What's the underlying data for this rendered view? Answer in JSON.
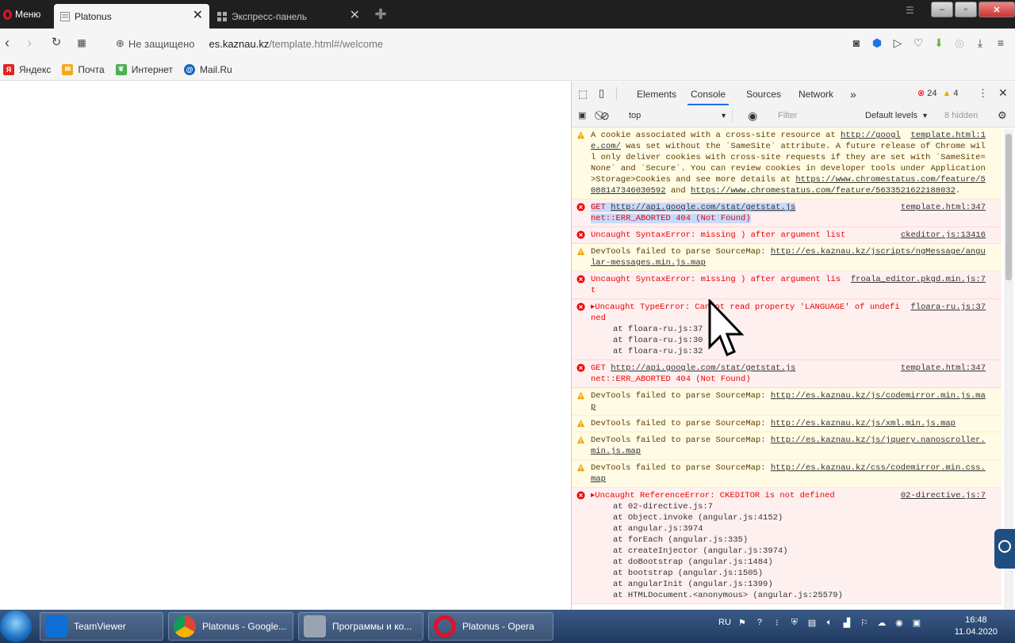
{
  "browser": {
    "menu_label": "Меню",
    "tabs": [
      {
        "title": "Platonus",
        "active": true
      },
      {
        "title": "Экспресс-панель",
        "active": false
      }
    ],
    "security_label": "Не защищено",
    "url_host": "es.kaznau.kz",
    "url_path": "/template.html#/welcome",
    "bookmarks": [
      {
        "label": "Яндекс",
        "color": "#e02424"
      },
      {
        "label": "Почта",
        "color": "#f2a81d"
      },
      {
        "label": "Интернет",
        "color": "#4caf50"
      },
      {
        "label": "Mail.Ru",
        "color": "#1565c0"
      }
    ]
  },
  "devtools": {
    "tabs": [
      "Elements",
      "Console",
      "Sources",
      "Network"
    ],
    "active_tab": "Console",
    "error_count": "24",
    "warning_count": "4",
    "context": "top",
    "filter_placeholder": "Filter",
    "levels": "Default levels",
    "hidden": "8 hidden",
    "messages": {
      "m1": {
        "type": "warn",
        "text1": "A cookie associated with a cross-site resource at ",
        "link": "http://google.com/",
        "text2": " was set without the `SameSite` attribute. A future release of Chrome will only deliver cookies with cross-site requests if they are set with `SameSite=None` and `Secure`. You can review cookies in developer tools under Application>Storage>Cookies and see more details at ",
        "link2": "https://www.chromestatus.com/feature/5088147346030592",
        "text3": " and ",
        "link3": "https://www.chromestatus.com/feature/5633521622188032",
        "text4": ".",
        "source": "template.html:1"
      },
      "m2": {
        "type": "error",
        "method": "GET",
        "link": "http://api.google.com/stat/getstat.js",
        "text": "net::ERR_ABORTED 404 (Not Found)",
        "source": "template.html:347"
      },
      "m3": {
        "type": "error",
        "text": "Uncaught SyntaxError: missing ) after argument list",
        "source": "ckeditor.js:13416"
      },
      "m4": {
        "type": "warn",
        "text": "DevTools failed to parse SourceMap: ",
        "link": "http://es.kaznau.kz/jscripts/ngMessage/angular-messages.min.js.map"
      },
      "m5": {
        "type": "error",
        "text": "Uncaught SyntaxError: missing ) after argument list",
        "source": "froala_editor.pkgd.min.js:7"
      },
      "m6": {
        "type": "error",
        "text": "▸Uncaught TypeError: Cannot read property 'LANGUAGE' of undefined",
        "source": "floara-ru.js:37",
        "trace": [
          "at floara-ru.js:37",
          "at floara-ru.js:30",
          "at floara-ru.js:32"
        ]
      },
      "m7": {
        "type": "error",
        "method": "GET",
        "link": "http://api.google.com/stat/getstat.js",
        "text": "net::ERR_ABORTED 404 (Not Found)",
        "source": "template.html:347"
      },
      "m8": {
        "type": "warn",
        "text": "DevTools failed to parse SourceMap: ",
        "link": "http://es.kaznau.kz/js/codemirror.min.js.map"
      },
      "m9": {
        "type": "warn",
        "text": "DevTools failed to parse SourceMap: ",
        "link": "http://es.kaznau.kz/js/xml.min.js.map"
      },
      "m10": {
        "type": "warn",
        "text": "DevTools failed to parse SourceMap: ",
        "link": "http://es.kaznau.kz/js/jquery.nanoscroller.min.js.map"
      },
      "m11": {
        "type": "warn",
        "text": "DevTools failed to parse SourceMap: ",
        "link": "http://es.kaznau.kz/css/codemirror.min.css.map"
      },
      "m12": {
        "type": "error",
        "text": "▸Uncaught ReferenceError: CKEDITOR is not defined",
        "source": "02-directive.js:7",
        "trace": [
          "at 02-directive.js:7",
          "at Object.invoke (angular.js:4152)",
          "at angular.js:3974",
          "at forEach (angular.js:335)",
          "at createInjector (angular.js:3974)",
          "at doBootstrap (angular.js:1484)",
          "at bootstrap (angular.js:1505)",
          "at angularInit (angular.js:1399)",
          "at HTMLDocument.<anonymous> (angular.js:25579)"
        ]
      }
    }
  },
  "taskbar": {
    "items": [
      {
        "label": "TeamViewer",
        "color": "#0e6fd6"
      },
      {
        "label": "Platonus - Google...",
        "color": "#ffffff"
      },
      {
        "label": "Программы и ко...",
        "color": "#9aa4b0"
      },
      {
        "label": "Platonus - Opera",
        "color": "#e0112b"
      }
    ],
    "lang": "RU",
    "time": "16:48",
    "date": "11.04.2020"
  },
  "colors": {
    "accent": "#1a73e8",
    "error": "#e00000",
    "warning": "#f2a600"
  }
}
